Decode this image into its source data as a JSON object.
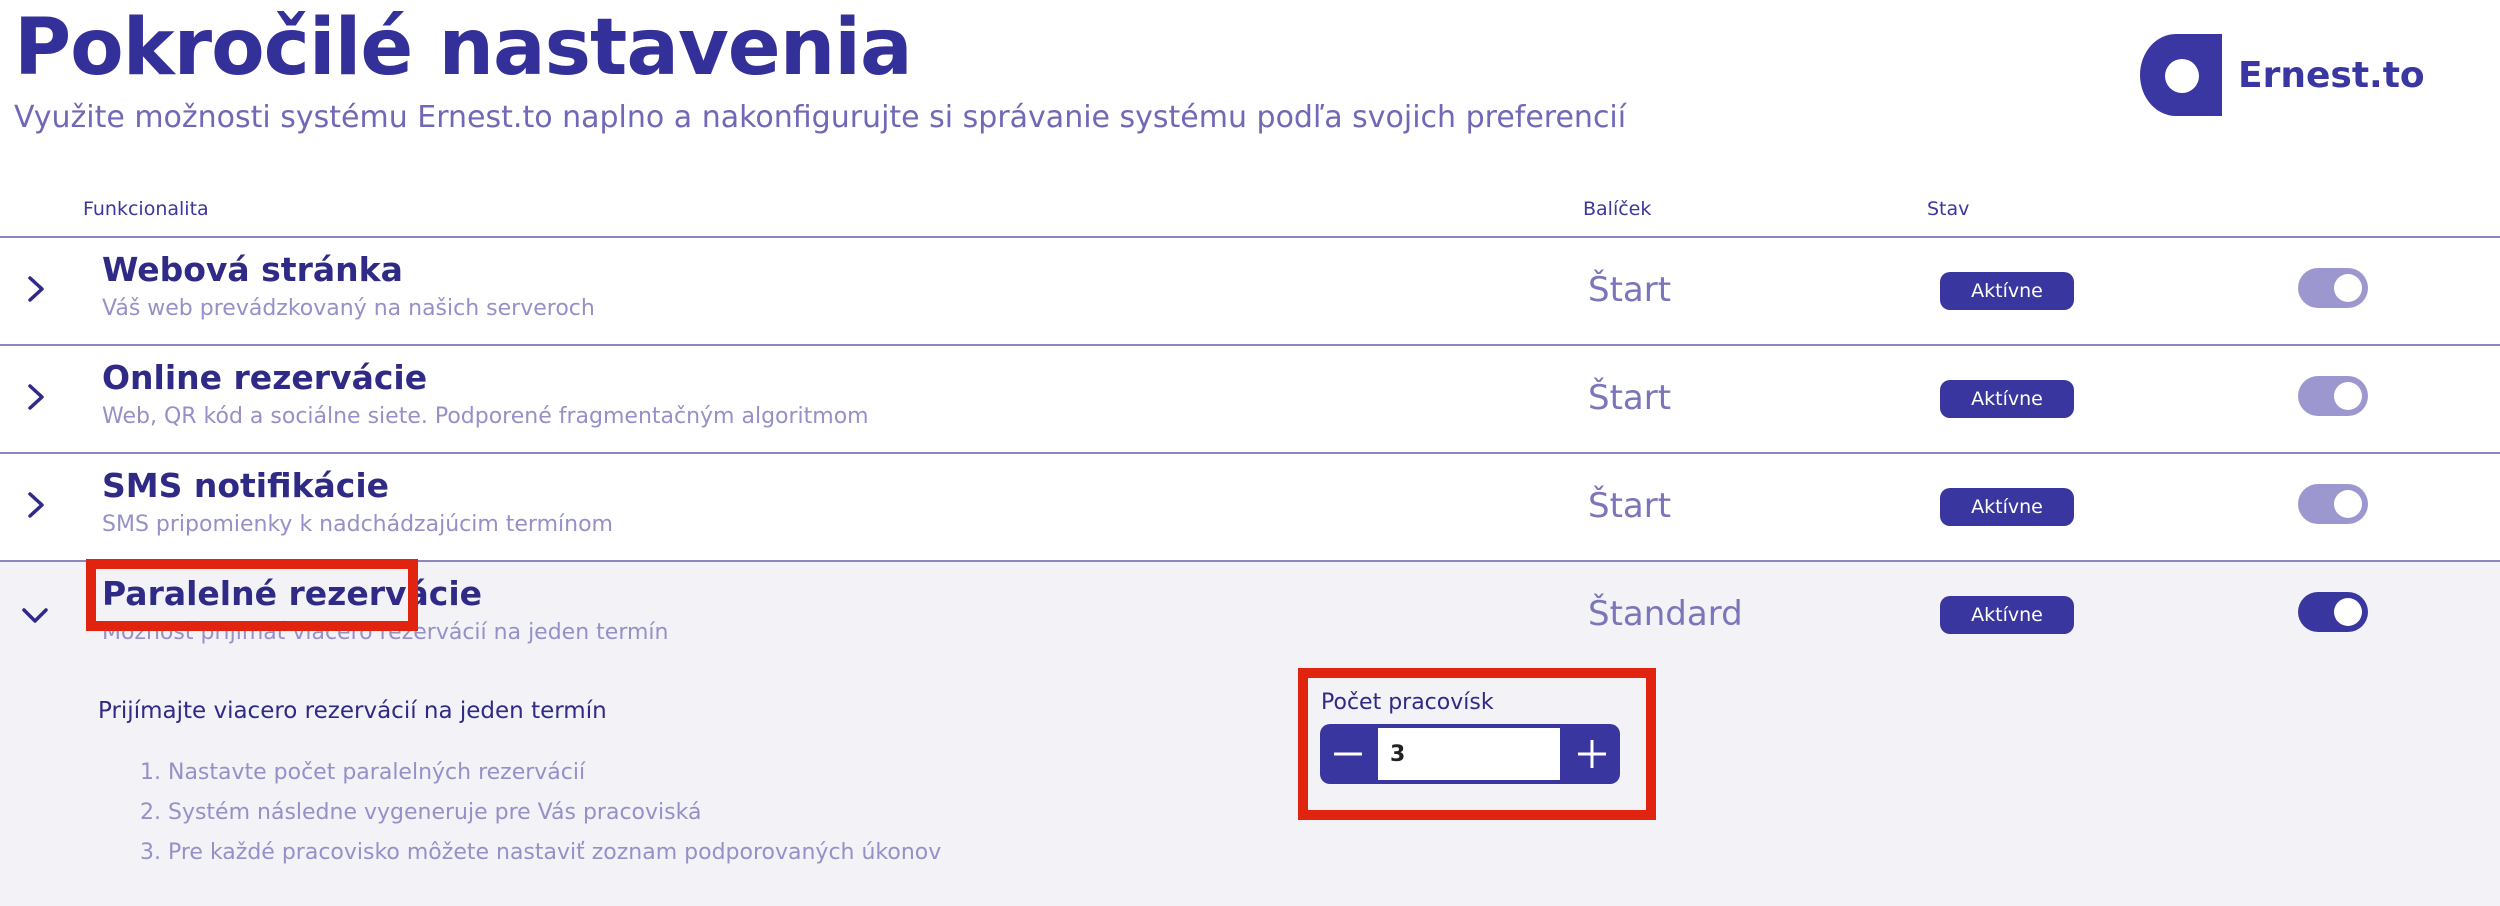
{
  "header": {
    "title": "Pokročilé nastavenia",
    "subtitle": "Využite možnosti systému Ernest.to naplno a nakonfigurujte si správanie systému podľa svojich preferencií",
    "brand": "Ernest.to"
  },
  "table": {
    "columns": {
      "feature": "Funkcionalita",
      "plan": "Balíček",
      "status": "Stav"
    },
    "rows": [
      {
        "title": "Webová stránka",
        "description": "Váš web prevádzkovaný na našich serveroch",
        "plan": "Štart",
        "status": "Aktívne",
        "toggle_on": false,
        "expanded": false
      },
      {
        "title": "Online rezervácie",
        "description": "Web, QR kód a sociálne siete. Podporené fragmentačným algoritmom",
        "plan": "Štart",
        "status": "Aktívne",
        "toggle_on": false,
        "expanded": false
      },
      {
        "title": "SMS notifikácie",
        "description": "SMS pripomienky k nadchádzajúcim termínom",
        "plan": "Štart",
        "status": "Aktívne",
        "toggle_on": false,
        "expanded": false
      },
      {
        "title": "Paralelné rezervácie",
        "description": "Možnosť prijímať viacero rezervácií na jeden termín",
        "plan": "Štandard",
        "status": "Aktívne",
        "toggle_on": true,
        "expanded": true
      }
    ]
  },
  "detail": {
    "heading": "Prijímajte viacero rezervácií na jeden termín",
    "steps": [
      "1. Nastavte počet paralelných rezervácií",
      "2. Systém následne vygeneruje pre Vás pracoviská",
      "3. Pre každé pracovisko môžete nastaviť zoznam podporovaných úkonov"
    ],
    "stepper": {
      "label": "Počet pracovísk",
      "value": "3"
    }
  },
  "colors": {
    "primary": "#3a36a0",
    "toggle_off": "#9c98cf",
    "highlight": "#e02410"
  },
  "icons": {
    "collapsed": "chevron-right-icon",
    "expanded": "chevron-down-icon",
    "decrement": "minus-icon",
    "increment": "plus-icon"
  }
}
